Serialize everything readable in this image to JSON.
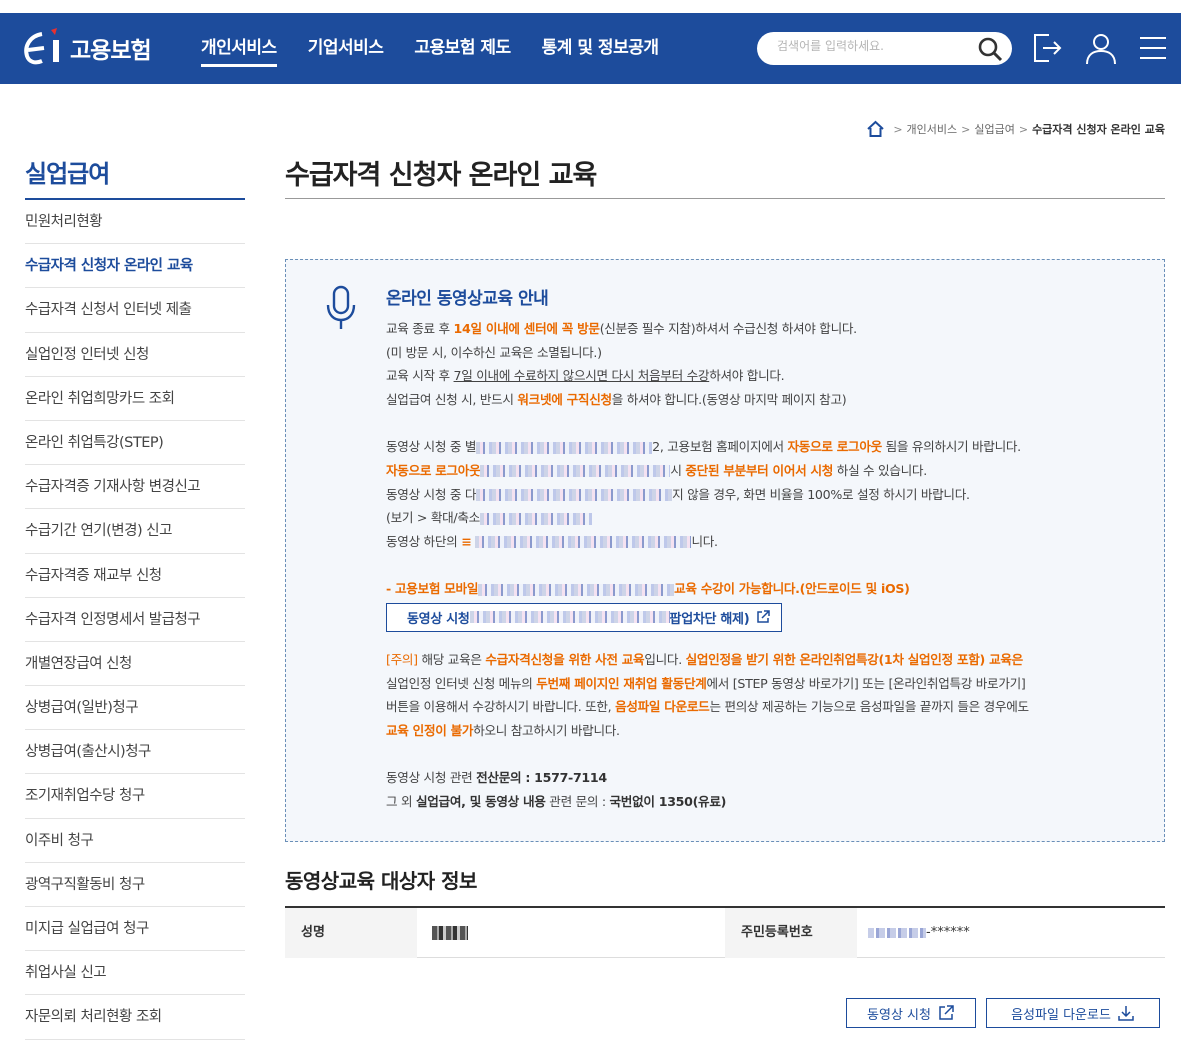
{
  "header": {
    "logo_text": "고용보험",
    "nav": [
      "개인서비스",
      "기업서비스",
      "고용보험 제도",
      "통계 및 정보공개"
    ],
    "search_placeholder": "검색어를 입력하세요."
  },
  "breadcrumb": [
    "개인서비스",
    "실업급여",
    "수급자격 신청자 온라인 교육"
  ],
  "sidebar": {
    "title": "실업급여",
    "items": [
      "민원처리현황",
      "수급자격 신청자 온라인 교육",
      "수급자격 신청서 인터넷 제출",
      "실업인정 인터넷 신청",
      "온라인 취업희망카드 조회",
      "온라인 취업특강(STEP)",
      "수급자격증 기재사항 변경신고",
      "수급기간 연기(변경) 신고",
      "수급자격증 재교부 신청",
      "수급자격 인정명세서 발급청구",
      "개별연장급여 신청",
      "상병급여(일반)청구",
      "상병급여(출산시)청구",
      "조기재취업수당 청구",
      "이주비 청구",
      "광역구직활동비 청구",
      "미지급 실업급여 청구",
      "취업사실 신고",
      "자문의뢰 처리현황 조회"
    ]
  },
  "main": {
    "title": "수급자격 신청자 온라인 교육",
    "notice": {
      "title": "온라인 동영상교육 안내",
      "l1a": "교육 종료 후 ",
      "l1b": "14일 이내에 센터에 꼭 방문",
      "l1c": "(신분증 필수 지참)하셔서 수급신청 하셔야 합니다.",
      "l2": "(미 방문 시, 이수하신 교육은 소멸됩니다.)",
      "l3a": "교육 시작 후 ",
      "l3b": "7일 이내에 수료하지 않으시면 다시 처음부터 수강",
      "l3c": "하셔야 합니다.",
      "l4a": "실업급여 신청 시, 반드시 ",
      "l4b": "워크넷에 구직신청",
      "l4c": "을 하셔야 합니다.(동영상 마지막 페이지 참고)",
      "l5a": "동영상 시청 중 별",
      "l5b": "2, 고용보험 홈페이지에서 ",
      "l5c": "자동으로 로그아웃",
      "l5d": " 됨을 유의하시기 바랍니다.",
      "l6a": "자동으로 로그아웃",
      "l6b": "시 ",
      "l6c": "중단된 부분부터 이어서 시청",
      "l6d": " 하실 수 있습니다.",
      "l7a": "동영상 시청 중 다",
      "l7b": "지 않을 경우, 화면 비율을 100%로 설정 하시기 바랍니다.",
      "l8a": "(보기 > 확대/축소",
      "l9a": "동영상 하단의 ",
      "l9b": "≡ ",
      "l9c": "니다.",
      "l10a": "- 고용보험 모바일",
      "l10b": "교육 수강이 가능합니다.(안드로이드 및 iOS)",
      "btn_a": "동영상 시청 ",
      "btn_b": "팝업차단 해제)",
      "l11a": "[주의]",
      "l11b": " 해당 교육은 ",
      "l11c": "수급자격신청을 위한 사전 교육",
      "l11d": "입니다. ",
      "l11e": "실업인정을 받기 위한 온라인취업특강(1차 실업인정 포함) 교육은",
      "l12a": "실업인정 인터넷 신청 메뉴의 ",
      "l12b": "두번째 페이지인 재취업 활동단계",
      "l12c": "에서 [STEP 동영상 바로가기] 또는 [온라인취업특강 바로가기]",
      "l13a": "버튼을 이용해서 수강하시기 바랍니다. 또한, ",
      "l13b": "음성파일 다운로드",
      "l13c": "는 편의상 제공하는 기능으로 음성파일을 끝까지 들은 경우에도",
      "l14a": "교육 인정이 불가",
      "l14b": "하오니 참고하시기 바랍니다.",
      "l15a": "동영상 시청 관련 ",
      "l15b": "전산문의 : 1577-7114",
      "l16a": "그 외 ",
      "l16b": "실업급여, 및 동영상 내용",
      "l16c": " 관련 문의 : ",
      "l16d": "국번없이 1350(유료)"
    },
    "subject": {
      "title": "동영상교육 대상자 정보",
      "name_label": "성명",
      "ssn_label": "주민등록번호",
      "ssn_value": "-******"
    },
    "buttons": {
      "watch": "동영상 시청",
      "download": "음성파일 다운로드"
    }
  }
}
